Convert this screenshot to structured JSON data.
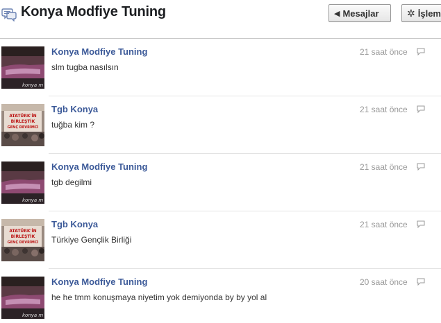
{
  "header": {
    "title": "Konya Modfiye Tuning",
    "messages_button": "Mesajlar",
    "actions_button": "İşlemler"
  },
  "messages": [
    {
      "sender": "Konya Modfiye Tuning",
      "text": "slm tugba nasılsın",
      "time": "21 saat önce",
      "avatar": "car-photo"
    },
    {
      "sender": "Tgb Konya",
      "text": "tuğba kim ?",
      "time": "21 saat önce",
      "avatar": "crowd-banner-photo"
    },
    {
      "sender": "Konya Modfiye Tuning",
      "text": "tgb degilmi",
      "time": "21 saat önce",
      "avatar": "car-photo"
    },
    {
      "sender": "Tgb Konya",
      "text": "Türkiye Gençlik Birliği",
      "time": "21 saat önce",
      "avatar": "crowd-banner-photo"
    },
    {
      "sender": "Konya Modfiye Tuning",
      "text": "he he tmm konuşmaya niyetim yok demiyonda by by yol al",
      "time": "20 saat önce",
      "avatar": "car-photo"
    }
  ],
  "colors": {
    "sender_link": "#3b5998",
    "timestamp": "#999999",
    "title": "#1c1e21"
  }
}
